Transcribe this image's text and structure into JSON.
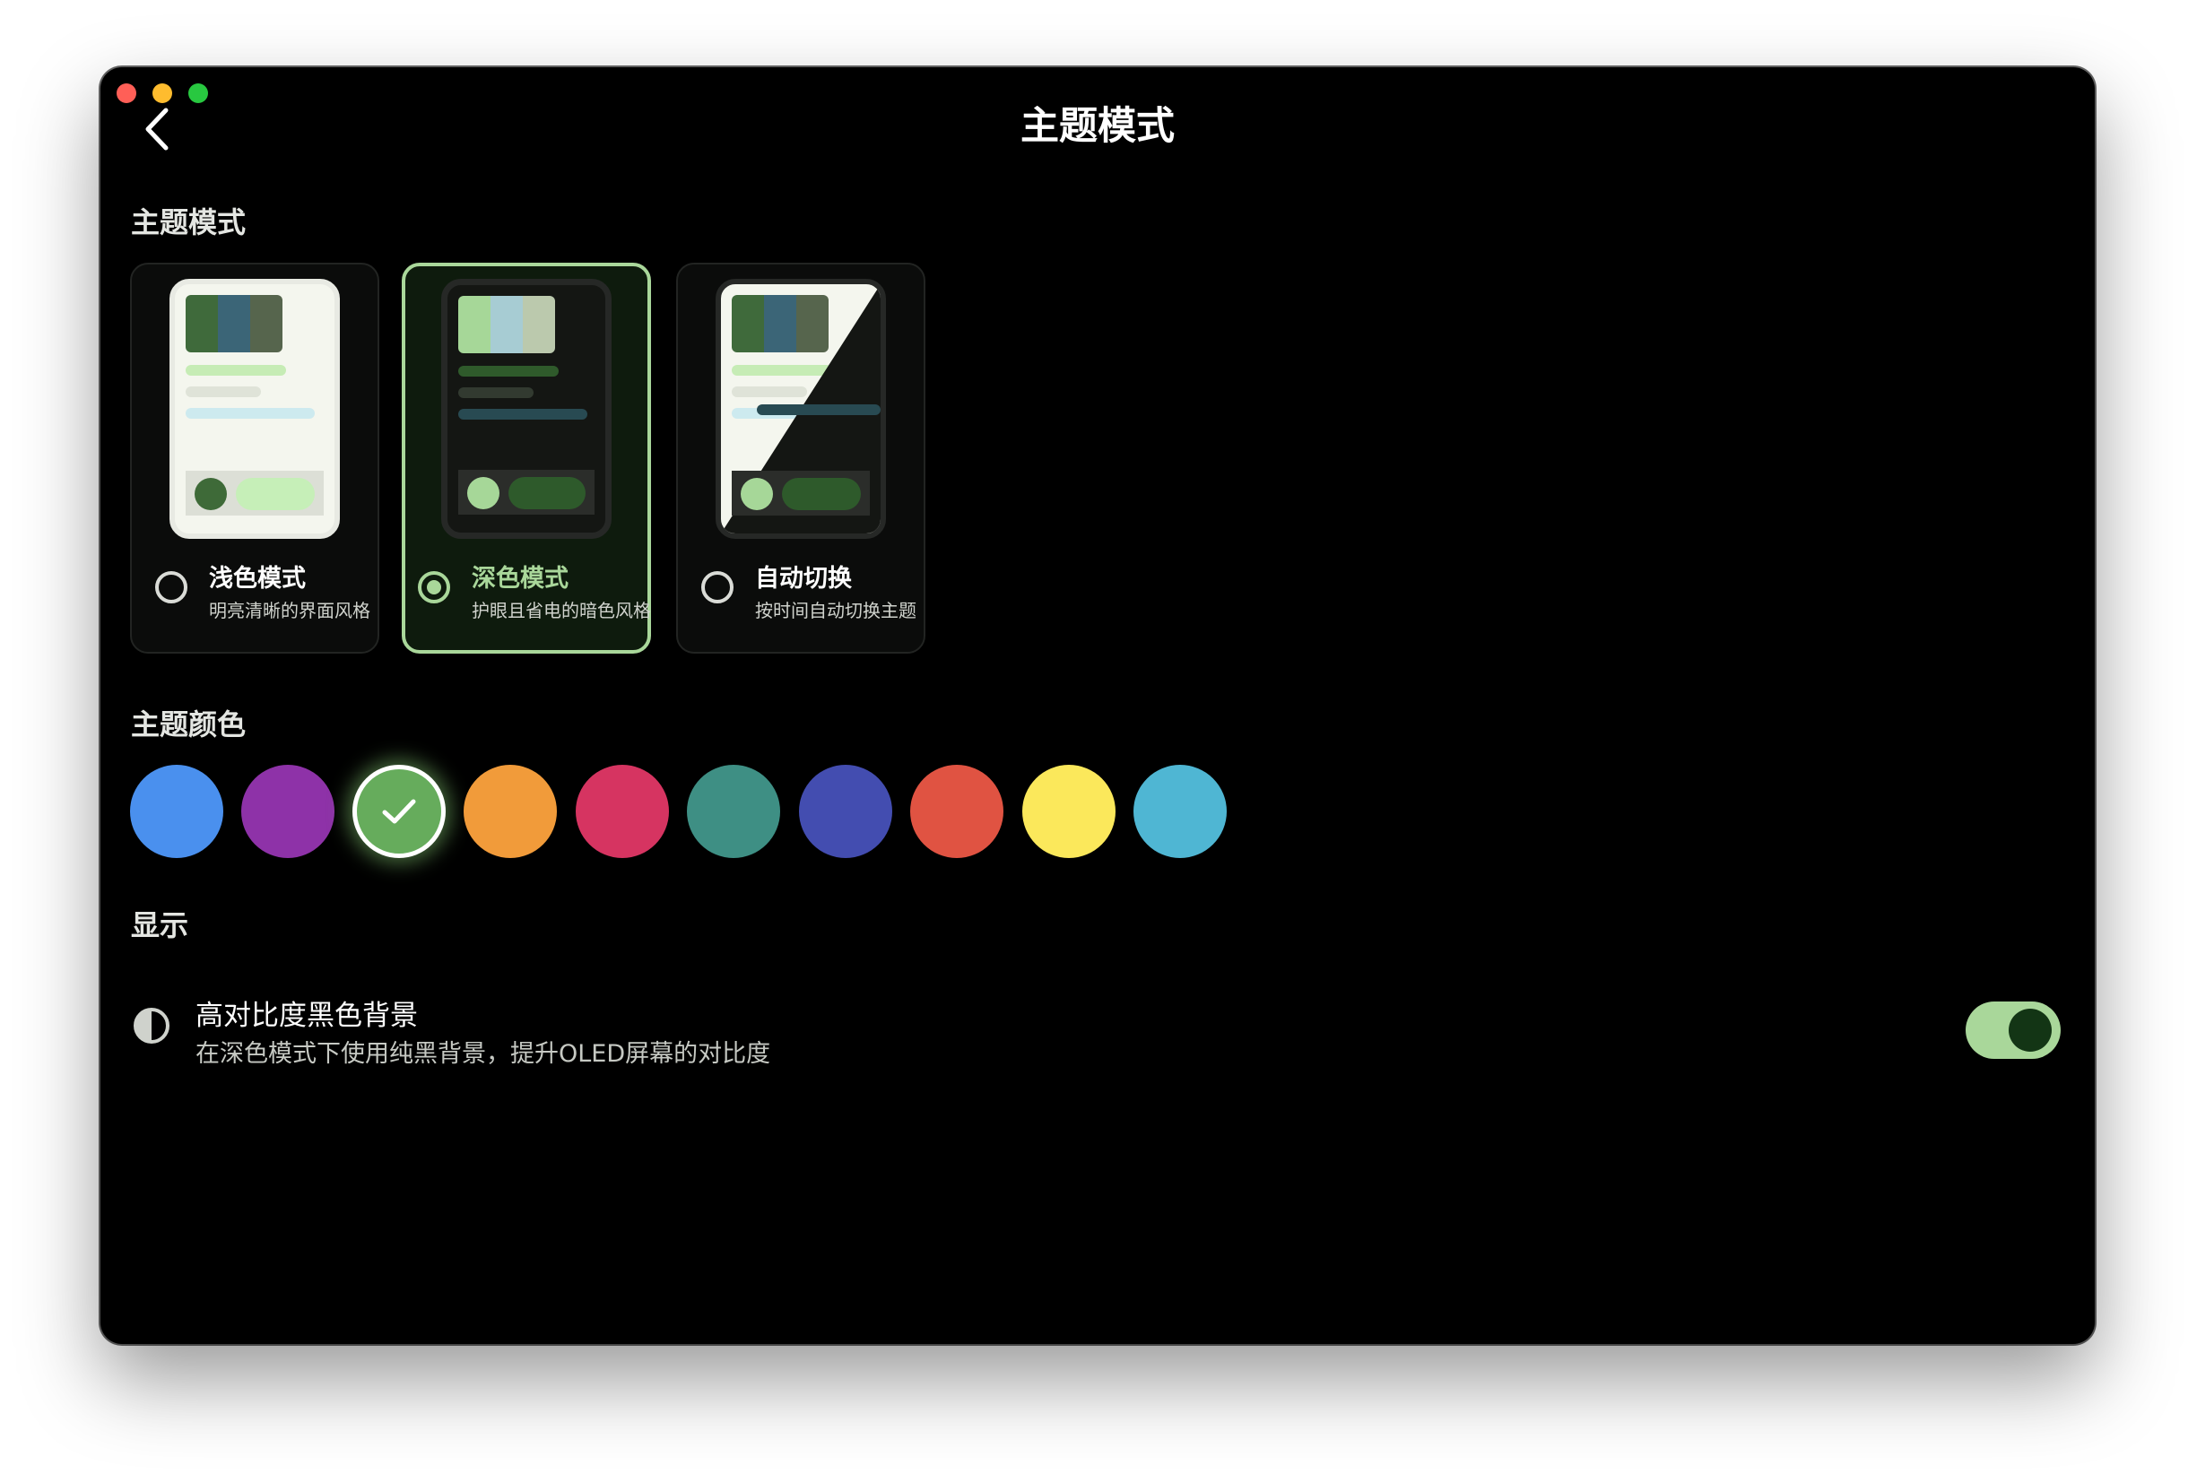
{
  "header": {
    "title": "主题模式"
  },
  "sections": {
    "theme_mode": "主题模式",
    "theme_color": "主题颜色",
    "display": "显示"
  },
  "modes": [
    {
      "name": "浅色模式",
      "description": "明亮清晰的界面风格",
      "selected": false
    },
    {
      "name": "深色模式",
      "description": "护眼且省电的暗色风格",
      "selected": true
    },
    {
      "name": "自动切换",
      "description": "按时间自动切换主题",
      "selected": false
    }
  ],
  "theme_colors": [
    {
      "color": "#4a90ee",
      "selected": false
    },
    {
      "color": "#8e32a8",
      "selected": false
    },
    {
      "color": "#66ac5c",
      "selected": true
    },
    {
      "color": "#f19b3a",
      "selected": false
    },
    {
      "color": "#d63461",
      "selected": false
    },
    {
      "color": "#3e8f84",
      "selected": false
    },
    {
      "color": "#434db0",
      "selected": false
    },
    {
      "color": "#e05342",
      "selected": false
    },
    {
      "color": "#fbe85b",
      "selected": false
    },
    {
      "color": "#4fb6d3",
      "selected": false
    }
  ],
  "display": {
    "high_contrast": {
      "title": "高对比度黑色背景",
      "description": "在深色模式下使用纯黑背景，提升OLED屏幕的对比度",
      "enabled": true,
      "icon": "contrast-icon"
    }
  },
  "accent_color": "#a9d79a"
}
